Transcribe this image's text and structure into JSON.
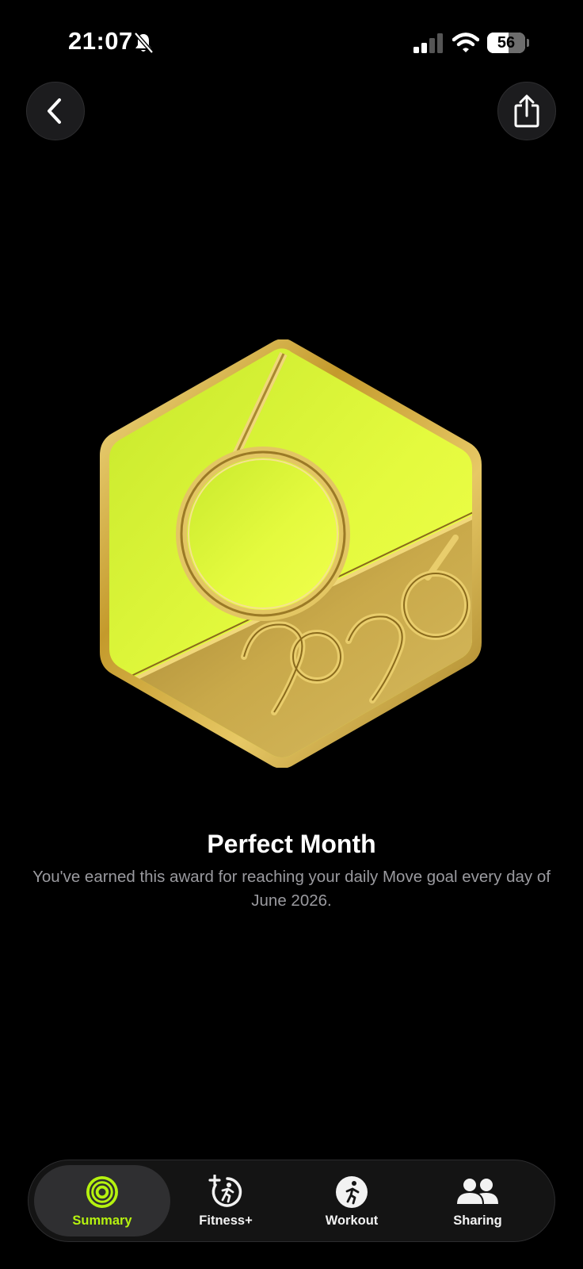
{
  "status_bar": {
    "time": "21:07",
    "battery_percent": "56",
    "battery_level": 0.56,
    "icons": [
      "bell-slash-icon",
      "cellular-signal-icon",
      "wifi-icon",
      "battery-icon"
    ]
  },
  "header": {
    "back_icon": "chevron-left-icon",
    "share_icon": "share-icon"
  },
  "award": {
    "badge_year": "2026",
    "badge_month_numeral": "6",
    "title": "Perfect Month",
    "description": "You've earned this award for reaching your daily Move goal every day of June 2026."
  },
  "tab_bar": {
    "tabs": [
      {
        "label": "Summary",
        "icon": "activity-rings-icon",
        "active": true
      },
      {
        "label": "Fitness+",
        "icon": "fitness-plus-icon",
        "active": false
      },
      {
        "label": "Workout",
        "icon": "running-figure-icon",
        "active": false
      },
      {
        "label": "Sharing",
        "icon": "people-icon",
        "active": false
      }
    ]
  },
  "colors": {
    "background": "#000000",
    "accent": "#b6f20f",
    "badge_green": "#dcf53a",
    "badge_gold": "#c9a94a"
  }
}
